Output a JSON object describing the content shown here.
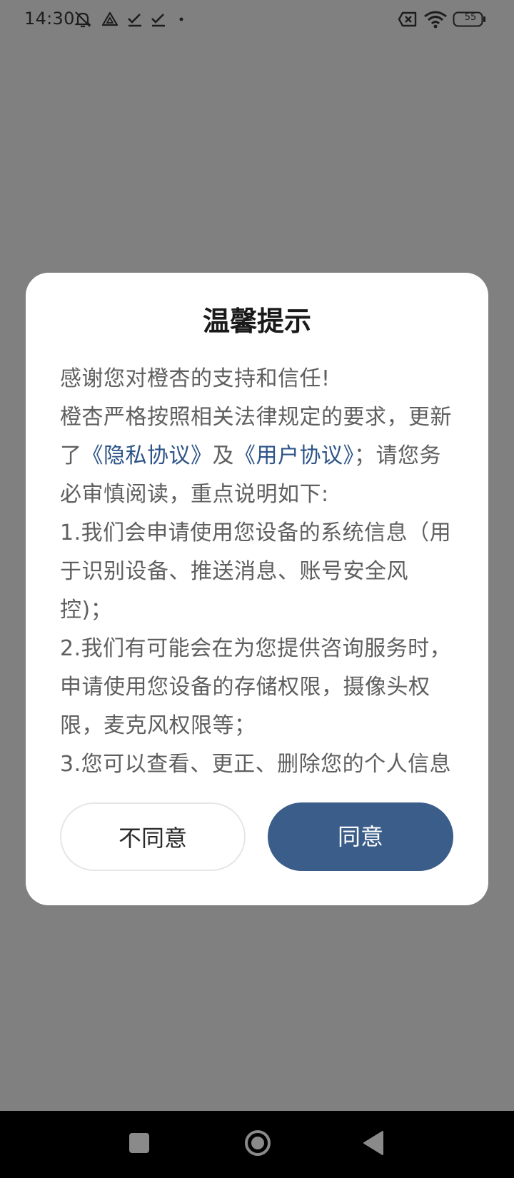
{
  "status_bar": {
    "time": "14:30",
    "left_icons": [
      "muted-bell-icon",
      "drive-icon",
      "check-icon",
      "check-icon",
      "dot-icon"
    ],
    "right_icons": [
      "sim-x-icon",
      "wifi-icon",
      "battery-icon"
    ],
    "battery_level": "55"
  },
  "dialog": {
    "title": "温馨提示",
    "intro": "感谢您对橙杏的支持和信任!",
    "para1_before": "橙杏严格按照相关法律规定的要求，更新了",
    "privacy_link": "《隐私协议》",
    "para1_and": "及",
    "user_link": "《用户协议》",
    "para1_after": "；请您务必审慎阅读，重点说明如下:",
    "item1": "1.我们会申请使用您设备的系统信息（用于识别设备、推送消息、账号安全风控)；",
    "item2": "2.我们有可能会在为您提供咨询服务时，申请使用您设备的存储权限，摄像头权限，麦克风权限等；",
    "item3": "3.您可以查看、更正、删除您的个人信息",
    "disagree_label": "不同意",
    "agree_label": "同意"
  },
  "colors": {
    "overlay": "#808080",
    "link": "#2d5488",
    "primary_button": "#3b5d8a"
  },
  "nav_bar": {
    "icons": [
      "recent-apps-icon",
      "home-icon",
      "back-icon"
    ]
  }
}
